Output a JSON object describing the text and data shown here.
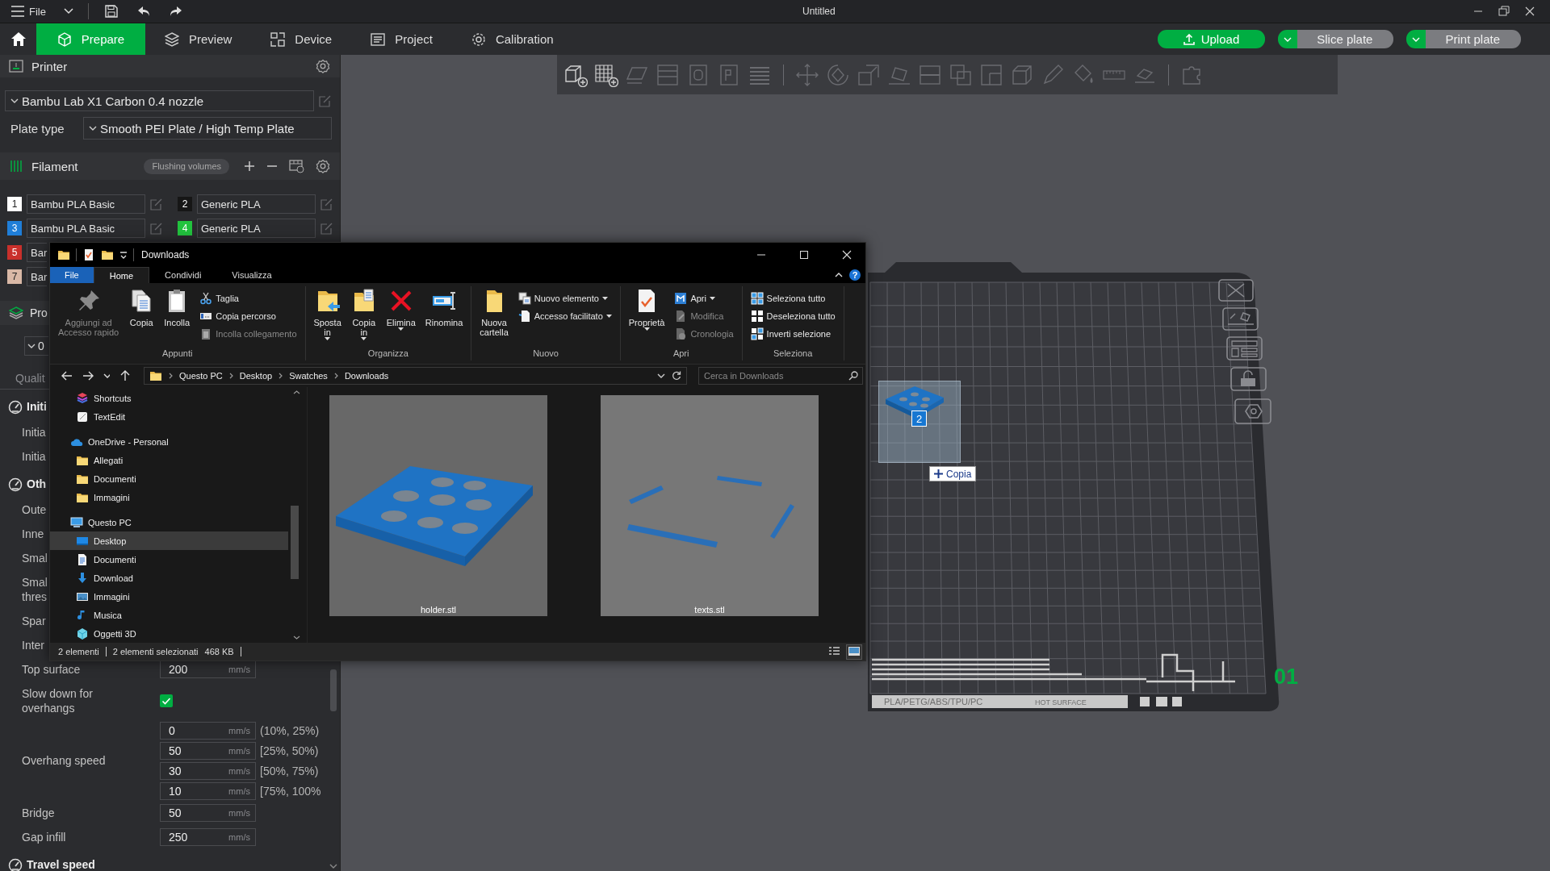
{
  "titlebar": {
    "menu": "File",
    "title": "Untitled"
  },
  "nav": {
    "tabs": [
      {
        "label": "Prepare",
        "selected": true
      },
      {
        "label": "Preview",
        "selected": false
      },
      {
        "label": "Device",
        "selected": false
      },
      {
        "label": "Project",
        "selected": false
      },
      {
        "label": "Calibration",
        "selected": false
      }
    ],
    "actions": [
      {
        "label": "Upload",
        "kind": "primary"
      },
      {
        "label": "Slice plate",
        "kind": "split"
      },
      {
        "label": "Print plate",
        "kind": "split"
      }
    ]
  },
  "printer": {
    "title": "Printer",
    "preset": "Bambu Lab X1 Carbon 0.4 nozzle",
    "plate_type_label": "Plate type",
    "plate_type": "Smooth PEI Plate / High Temp Plate"
  },
  "filament": {
    "title": "Filament",
    "flushing_button": "Flushing volumes",
    "rows": [
      {
        "slots": [
          {
            "number": "1",
            "name": "Bambu PLA Basic",
            "color": "#ffffff"
          },
          {
            "number": "2",
            "name": "Generic PLA",
            "color": "#161616"
          }
        ]
      },
      {
        "slots": [
          {
            "number": "3",
            "name": "Bambu PLA Basic",
            "color": "#1f7ed8"
          },
          {
            "number": "4",
            "name": "Generic PLA",
            "color": "#22c33e"
          }
        ]
      },
      {
        "slots": [
          {
            "number": "5",
            "name": "Bar",
            "color": "#c9302b"
          }
        ]
      },
      {
        "slots": [
          {
            "number": "7",
            "name": "Bar",
            "color": "#d9b8a6"
          }
        ]
      }
    ]
  },
  "process": {
    "title": "Pro",
    "preset": "0",
    "tab": "Qualit",
    "rows": [
      {
        "kind": "header",
        "label": "Initi"
      },
      {
        "kind": "label",
        "label": "Initia"
      },
      {
        "kind": "label",
        "label": "Initia"
      },
      {
        "kind": "header",
        "label": "Oth"
      },
      {
        "kind": "label",
        "label": "Oute"
      },
      {
        "kind": "label",
        "label": "Inne"
      },
      {
        "kind": "label",
        "label": "Smal"
      },
      {
        "kind": "label",
        "label": "Smal\nthres"
      },
      {
        "kind": "label",
        "label": "Spar"
      },
      {
        "kind": "label",
        "label": "Inter"
      },
      {
        "kind": "field",
        "label": "Top surface",
        "fields": [
          {
            "value": "200",
            "unit": "mm/s"
          }
        ]
      },
      {
        "kind": "check",
        "label": "Slow down for overhangs",
        "checked": true
      },
      {
        "kind": "field",
        "label": "Overhang speed",
        "fields": [
          {
            "value": "0",
            "unit": "mm/s",
            "range": "(10%, 25%)"
          },
          {
            "value": "50",
            "unit": "mm/s",
            "range": "[25%, 50%)"
          },
          {
            "value": "30",
            "unit": "mm/s",
            "range": "[50%, 75%)"
          },
          {
            "value": "10",
            "unit": "mm/s",
            "range": "[75%, 100%"
          }
        ]
      },
      {
        "kind": "field",
        "label": "Bridge",
        "fields": [
          {
            "value": "50",
            "unit": "mm/s"
          }
        ]
      },
      {
        "kind": "field",
        "label": "Gap infill",
        "fields": [
          {
            "value": "250",
            "unit": "mm/s"
          }
        ]
      },
      {
        "kind": "header",
        "label": "Travel speed"
      }
    ]
  },
  "explorer": {
    "title": "Downloads",
    "help": "?",
    "tabs": [
      {
        "label": "File",
        "kind": "file",
        "selected": false
      },
      {
        "label": "Home",
        "kind": "tab",
        "selected": true
      },
      {
        "label": "Condividi",
        "kind": "tab",
        "selected": false
      },
      {
        "label": "Visualizza",
        "kind": "tab",
        "selected": false
      }
    ],
    "ribbon": [
      {
        "label": "Appunti",
        "items": [
          {
            "kind": "large",
            "label": "Aggiungi ad\nAccesso rapido",
            "disabled": true,
            "dropdown": false
          },
          {
            "kind": "large",
            "label": "Copia",
            "disabled": false,
            "dropdown": false
          },
          {
            "kind": "large",
            "label": "Incolla",
            "disabled": false,
            "dropdown": false
          },
          {
            "kind": "stack",
            "items": [
              {
                "label": "Taglia",
                "disabled": false,
                "dropdown": false
              },
              {
                "label": "Copia percorso",
                "disabled": false,
                "dropdown": false
              },
              {
                "label": "Incolla collegamento",
                "disabled": true,
                "dropdown": false
              }
            ]
          }
        ]
      },
      {
        "label": "Organizza",
        "items": [
          {
            "kind": "large",
            "label": "Sposta\nin",
            "disabled": false,
            "dropdown": true
          },
          {
            "kind": "large",
            "label": "Copia\nin",
            "disabled": false,
            "dropdown": true
          },
          {
            "kind": "large",
            "label": "Elimina",
            "disabled": false,
            "dropdown": true
          },
          {
            "kind": "large",
            "label": "Rinomina",
            "disabled": false,
            "dropdown": false
          }
        ]
      },
      {
        "label": "Nuovo",
        "items": [
          {
            "kind": "large",
            "label": "Nuova\ncartella",
            "disabled": false,
            "dropdown": false
          },
          {
            "kind": "stack",
            "items": [
              {
                "label": "Nuovo elemento",
                "disabled": false,
                "dropdown": true
              },
              {
                "label": "Accesso facilitato",
                "disabled": false,
                "dropdown": true
              }
            ]
          }
        ]
      },
      {
        "label": "Apri",
        "items": [
          {
            "kind": "large",
            "label": "Proprietà",
            "disabled": false,
            "dropdown": true
          },
          {
            "kind": "stack",
            "items": [
              {
                "label": "Apri",
                "disabled": false,
                "dropdown": true
              },
              {
                "label": "Modifica",
                "disabled": true,
                "dropdown": false
              },
              {
                "label": "Cronologia",
                "disabled": true,
                "dropdown": false
              }
            ]
          }
        ]
      },
      {
        "label": "Seleziona",
        "items": [
          {
            "kind": "stack",
            "items": [
              {
                "label": "Seleziona tutto",
                "disabled": false,
                "dropdown": false
              },
              {
                "label": "Deseleziona tutto",
                "disabled": false,
                "dropdown": false
              },
              {
                "label": "Inverti selezione",
                "disabled": false,
                "dropdown": false
              }
            ]
          }
        ]
      }
    ],
    "address": {
      "crumbs": [
        "Questo PC",
        "Desktop",
        "Swatches",
        "Downloads"
      ]
    },
    "search": {
      "placeholder": "Cerca in Downloads"
    },
    "nav_pane": [
      {
        "label": "Shortcuts",
        "selected": false
      },
      {
        "label": "TextEdit",
        "selected": false
      },
      {
        "label": "OneDrive - Personal",
        "selected": false,
        "children": [
          {
            "label": "Allegati",
            "selected": false
          },
          {
            "label": "Documenti",
            "selected": false
          },
          {
            "label": "Immagini",
            "selected": false
          }
        ]
      },
      {
        "label": "Questo PC",
        "selected": false,
        "children": [
          {
            "label": "Desktop",
            "selected": true
          },
          {
            "label": "Documenti",
            "selected": false
          },
          {
            "label": "Download",
            "selected": false
          },
          {
            "label": "Immagini",
            "selected": false
          },
          {
            "label": "Musica",
            "selected": false
          },
          {
            "label": "Oggetti 3D",
            "selected": false
          }
        ]
      }
    ],
    "files": [
      {
        "name": "holder.stl",
        "kind": "picture"
      },
      {
        "name": "texts.stl",
        "kind": "picture"
      }
    ],
    "status": {
      "items": "2 elementi",
      "selection": "2 elementi selezionati",
      "size": "468 KB"
    },
    "views": [
      {
        "selected": false
      },
      {
        "selected": true
      }
    ]
  },
  "viewport": {
    "plate_number": "01",
    "plate_labels": [
      "PLA/PETG/ABS/TPU/PC",
      "HOT SURFACE"
    ],
    "drag": {
      "count": "2",
      "effect": "Copia"
    }
  }
}
